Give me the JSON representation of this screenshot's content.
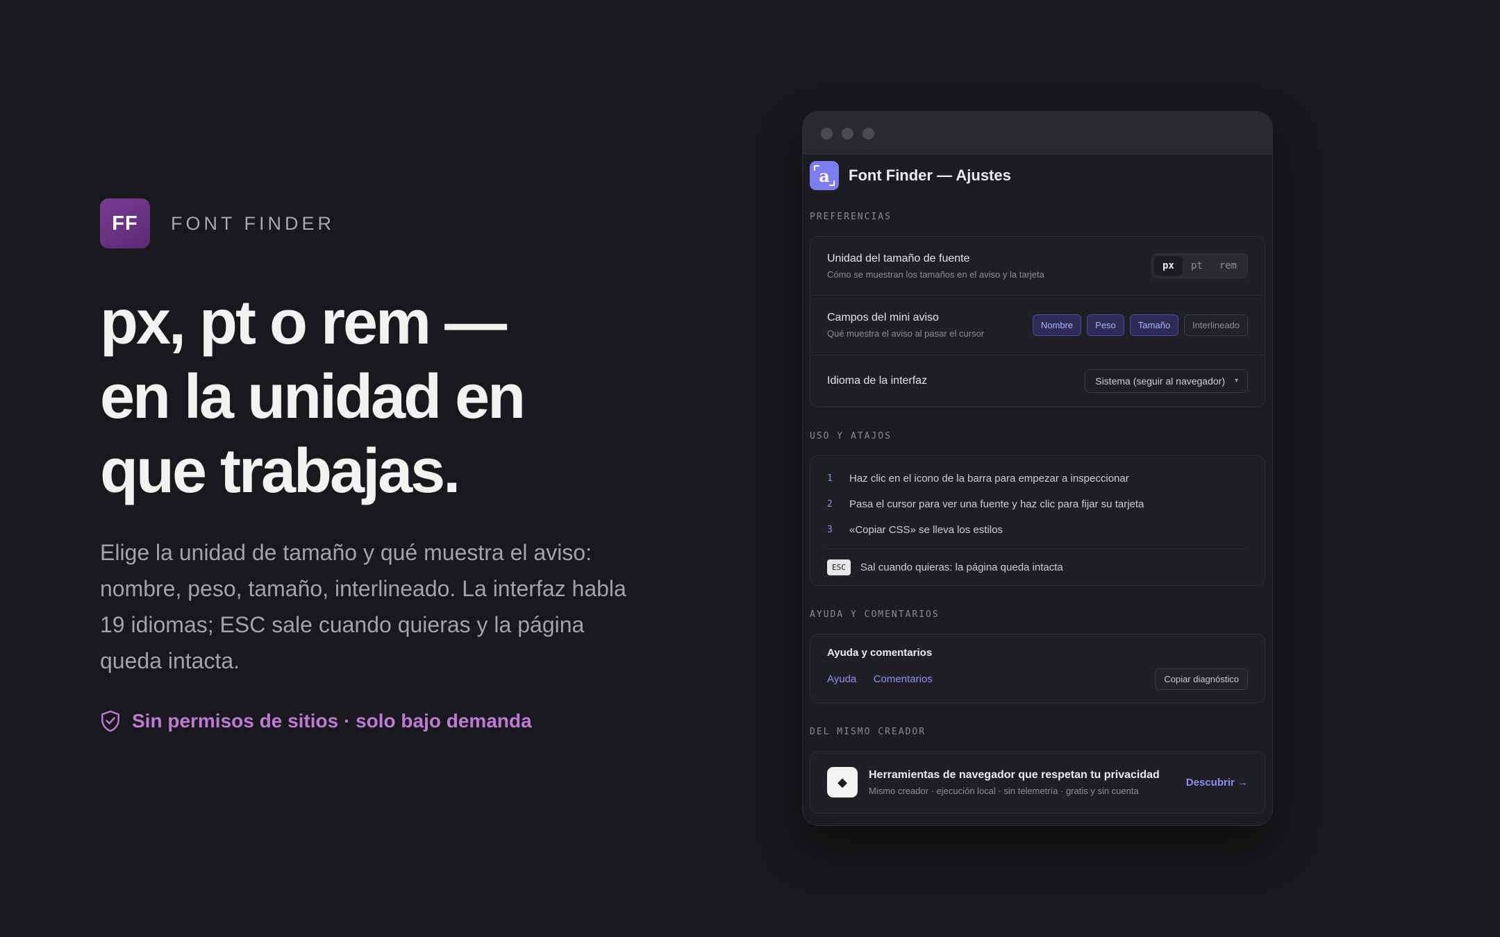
{
  "brand": {
    "logo_text": "FF",
    "name": "FONT FINDER",
    "logo_color": "#6b3183"
  },
  "hero": {
    "title_lines": [
      "px, pt o rem —",
      "en la unidad en",
      "que trabajas."
    ],
    "description": "Elige la unidad de tamaño y qué muestra el aviso: nombre, peso, tamaño, interlineado. La interfaz habla 19 idiomas; ESC sale cuando quieras y la página queda intacta.",
    "privacy_icon": "shield-check-icon",
    "privacy_text": "Sin permisos de sitios · solo bajo demanda",
    "privacy_color": "#c07ad6"
  },
  "window": {
    "app_icon": "font-finder-app-icon",
    "app_icon_glyph": "a",
    "app_title": "Font Finder — Ajustes",
    "accent": "#7c7cf0",
    "preferences": {
      "section_label": "PREFERENCIAS",
      "unit": {
        "title": "Unidad del tamaño de fuente",
        "subtitle": "Cómo se muestran los tamaños en el aviso y la tarjeta",
        "options": [
          "px",
          "pt",
          "rem"
        ],
        "selected": "px"
      },
      "fields": {
        "title": "Campos del mini aviso",
        "subtitle": "Qué muestra el aviso al pasar el cursor",
        "chips": [
          {
            "label": "Nombre",
            "on": true
          },
          {
            "label": "Peso",
            "on": true
          },
          {
            "label": "Tamaño",
            "on": true
          },
          {
            "label": "Interlineado",
            "on": false
          }
        ]
      },
      "language": {
        "title": "Idioma de la interfaz",
        "value": "Sistema (seguir al navegador)"
      }
    },
    "usage": {
      "section_label": "USO Y ATAJOS",
      "steps": [
        {
          "num": "1",
          "text": "Haz clic en el icono de la barra para empezar a inspeccionar"
        },
        {
          "num": "2",
          "text": "Pasa el cursor para ver una fuente y haz clic para fijar su tarjeta"
        },
        {
          "num": "3",
          "text": "«Copiar CSS» se lleva los estilos"
        }
      ],
      "esc_key": "ESC",
      "esc_text": "Sal cuando quieras: la página queda intacta"
    },
    "help": {
      "section_label": "AYUDA Y COMENTARIOS",
      "title": "Ayuda y comentarios",
      "link_help": "Ayuda",
      "link_feedback": "Comentarios",
      "copy_button": "Copiar diagnóstico"
    },
    "creator": {
      "section_label": "DEL MISMO CREADOR",
      "icon": "diamond-icon",
      "title": "Herramientas de navegador que respetan tu privacidad",
      "subtitle": "Mismo creador · ejecución local · sin telemetría · gratis y sin cuenta",
      "cta": "Descubrir →"
    }
  }
}
